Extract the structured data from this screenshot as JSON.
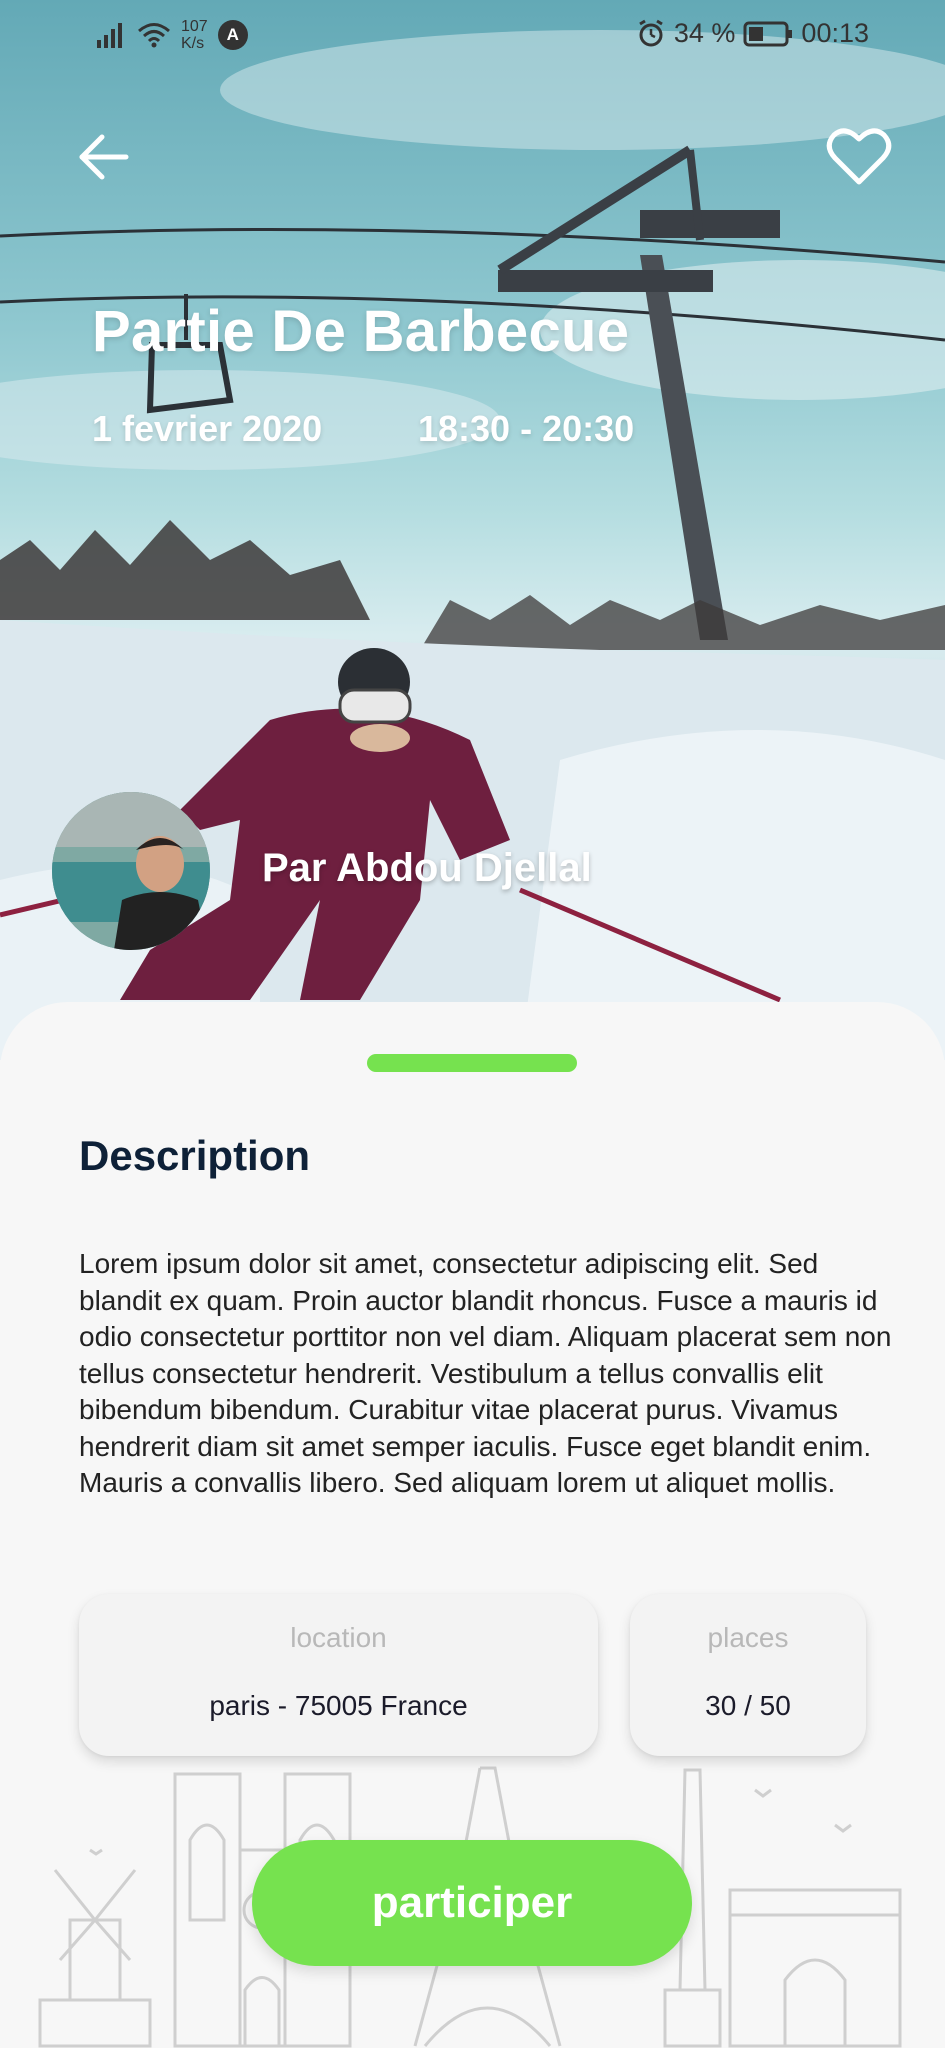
{
  "status_bar": {
    "network_speed_value": "107",
    "network_speed_unit": "K/s",
    "assistant_badge": "A",
    "battery": "34 %",
    "time": "00:13"
  },
  "event": {
    "title": "Partie De Barbecue",
    "date": "1 fevrier 2020",
    "time_range": "18:30 - 20:30",
    "organizer": "Par Abdou Djellal"
  },
  "details": {
    "heading": "Description",
    "text": "Lorem ipsum dolor sit amet, consectetur adipiscing elit. Sed blandit ex quam. Proin auctor blandit rhoncus. Fusce a mauris id odio consectetur porttitor non vel diam. Aliquam placerat sem non tellus consectetur hendrerit. Vestibulum a tellus convallis elit bibendum bibendum. Curabitur vitae placerat purus. Vivamus hendrerit diam sit amet semper iaculis. Fusce eget blandit enim. Mauris a convallis libero. Sed aliquam lorem ut aliquet mollis.",
    "location_label": "location",
    "location_value": "paris - 75005 France",
    "places_label": "places",
    "places_value": "30 / 50"
  },
  "actions": {
    "participate_label": "participer"
  },
  "icons": {
    "back": "arrow-left-icon",
    "favorite": "heart-outline-icon",
    "signal": "signal-icon",
    "wifi": "wifi-icon",
    "alarm": "alarm-icon",
    "battery": "battery-icon"
  },
  "colors": {
    "accent_green": "#76e24f",
    "heading_navy": "#0e2138",
    "label_gray": "#b8b8b8"
  }
}
